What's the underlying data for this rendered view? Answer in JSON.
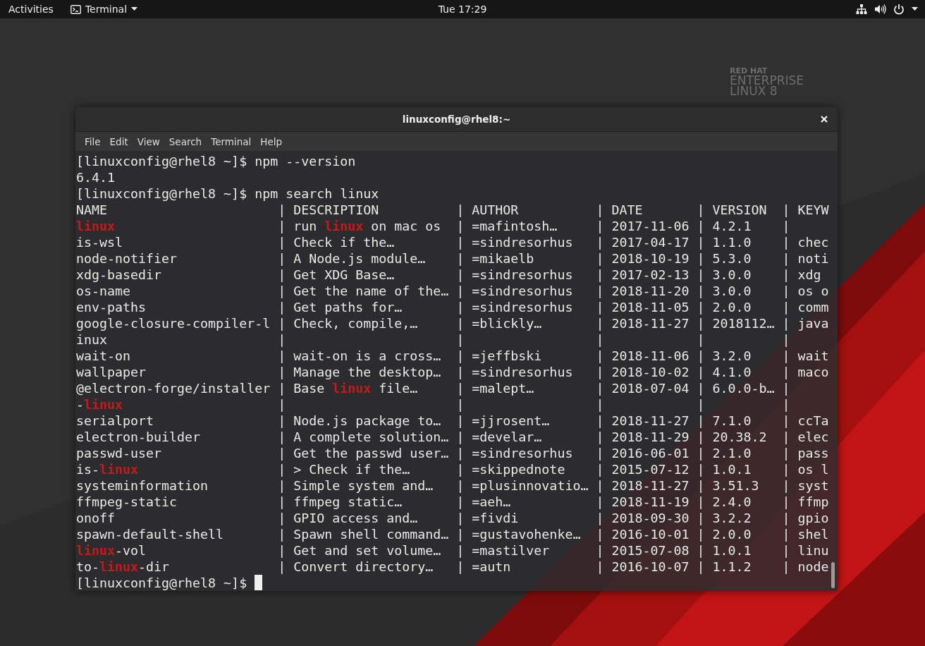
{
  "top_bar": {
    "activities": "Activities",
    "app_menu": "Terminal",
    "clock": "Tue 17:29"
  },
  "wallpaper": {
    "brand": [
      "RED HAT",
      "ENTERPRISE",
      "LINUX 8"
    ]
  },
  "window": {
    "title": "linuxconfig@rhel8:~",
    "menu": [
      "File",
      "Edit",
      "View",
      "Search",
      "Terminal",
      "Help"
    ],
    "lines": [
      {
        "cursor": false,
        "cells": [
          [
            {
              "text": "[linuxconfig@rhel8 ~]$ npm --version",
              "match": false
            }
          ]
        ]
      },
      {
        "cursor": false,
        "cells": [
          [
            {
              "text": "6.4.1",
              "match": false
            }
          ]
        ]
      },
      {
        "cursor": false,
        "cells": [
          [
            {
              "text": "[linuxconfig@rhel8 ~]$ npm search linux",
              "match": false
            }
          ]
        ]
      },
      {
        "cursor": false,
        "cells": [
          [
            {
              "text": "NAME",
              "match": false
            }
          ],
          [
            {
              "text": "| DESCRIPTION",
              "match": false
            }
          ],
          [
            {
              "text": "| AUTHOR",
              "match": false
            }
          ],
          [
            {
              "text": "| DATE",
              "match": false
            }
          ],
          [
            {
              "text": "| VERSION",
              "match": false
            }
          ],
          [
            {
              "text": "| KEYW",
              "match": false
            }
          ]
        ]
      },
      {
        "cursor": false,
        "cells": [
          [
            {
              "text": "linux",
              "match": true
            }
          ],
          [
            {
              "text": "| run ",
              "match": false
            },
            {
              "text": "linux",
              "match": true
            },
            {
              "text": " on mac os",
              "match": false
            }
          ],
          [
            {
              "text": "| =mafintosh…",
              "match": false
            }
          ],
          [
            {
              "text": "| 2017-11-06",
              "match": false
            }
          ],
          [
            {
              "text": "| 4.2.1",
              "match": false
            }
          ],
          [
            {
              "text": "|",
              "match": false
            }
          ]
        ]
      },
      {
        "cursor": false,
        "cells": [
          [
            {
              "text": "is-wsl",
              "match": false
            }
          ],
          [
            {
              "text": "| Check if the…",
              "match": false
            }
          ],
          [
            {
              "text": "| =sindresorhus",
              "match": false
            }
          ],
          [
            {
              "text": "| 2017-04-17",
              "match": false
            }
          ],
          [
            {
              "text": "| 1.1.0",
              "match": false
            }
          ],
          [
            {
              "text": "| chec",
              "match": false
            }
          ]
        ]
      },
      {
        "cursor": false,
        "cells": [
          [
            {
              "text": "node-notifier",
              "match": false
            }
          ],
          [
            {
              "text": "| A Node.js module…",
              "match": false
            }
          ],
          [
            {
              "text": "| =mikaelb",
              "match": false
            }
          ],
          [
            {
              "text": "| 2018-10-19",
              "match": false
            }
          ],
          [
            {
              "text": "| 5.3.0",
              "match": false
            }
          ],
          [
            {
              "text": "| noti",
              "match": false
            }
          ]
        ]
      },
      {
        "cursor": false,
        "cells": [
          [
            {
              "text": "xdg-basedir",
              "match": false
            }
          ],
          [
            {
              "text": "| Get XDG Base…",
              "match": false
            }
          ],
          [
            {
              "text": "| =sindresorhus",
              "match": false
            }
          ],
          [
            {
              "text": "| 2017-02-13",
              "match": false
            }
          ],
          [
            {
              "text": "| 3.0.0",
              "match": false
            }
          ],
          [
            {
              "text": "| xdg",
              "match": false
            }
          ]
        ]
      },
      {
        "cursor": false,
        "cells": [
          [
            {
              "text": "os-name",
              "match": false
            }
          ],
          [
            {
              "text": "| Get the name of the…",
              "match": false
            }
          ],
          [
            {
              "text": "| =sindresorhus",
              "match": false
            }
          ],
          [
            {
              "text": "| 2018-11-20",
              "match": false
            }
          ],
          [
            {
              "text": "| 3.0.0",
              "match": false
            }
          ],
          [
            {
              "text": "| os o",
              "match": false
            }
          ]
        ]
      },
      {
        "cursor": false,
        "cells": [
          [
            {
              "text": "env-paths",
              "match": false
            }
          ],
          [
            {
              "text": "| Get paths for…",
              "match": false
            }
          ],
          [
            {
              "text": "| =sindresorhus",
              "match": false
            }
          ],
          [
            {
              "text": "| 2018-11-05",
              "match": false
            }
          ],
          [
            {
              "text": "| 2.0.0",
              "match": false
            }
          ],
          [
            {
              "text": "| comm",
              "match": false
            }
          ]
        ]
      },
      {
        "cursor": false,
        "cells": [
          [
            {
              "text": "google-closure-compiler-l",
              "match": false
            }
          ],
          [
            {
              "text": "| Check, compile,…",
              "match": false
            }
          ],
          [
            {
              "text": "| =blickly…",
              "match": false
            }
          ],
          [
            {
              "text": "| 2018-11-27",
              "match": false
            }
          ],
          [
            {
              "text": "| 2018112…",
              "match": false
            }
          ],
          [
            {
              "text": "| java",
              "match": false
            }
          ]
        ]
      },
      {
        "cursor": false,
        "cells": [
          [
            {
              "text": "inux",
              "match": false
            }
          ],
          [
            {
              "text": "|",
              "match": false
            }
          ],
          [
            {
              "text": "|",
              "match": false
            }
          ],
          [
            {
              "text": "|",
              "match": false
            }
          ],
          [
            {
              "text": "|",
              "match": false
            }
          ],
          [
            {
              "text": "|",
              "match": false
            }
          ]
        ]
      },
      {
        "cursor": false,
        "cells": [
          [
            {
              "text": "wait-on",
              "match": false
            }
          ],
          [
            {
              "text": "| wait-on is a cross…",
              "match": false
            }
          ],
          [
            {
              "text": "| =jeffbski",
              "match": false
            }
          ],
          [
            {
              "text": "| 2018-11-06",
              "match": false
            }
          ],
          [
            {
              "text": "| 3.2.0",
              "match": false
            }
          ],
          [
            {
              "text": "| wait",
              "match": false
            }
          ]
        ]
      },
      {
        "cursor": false,
        "cells": [
          [
            {
              "text": "wallpaper",
              "match": false
            }
          ],
          [
            {
              "text": "| Manage the desktop…",
              "match": false
            }
          ],
          [
            {
              "text": "| =sindresorhus",
              "match": false
            }
          ],
          [
            {
              "text": "| 2018-10-02",
              "match": false
            }
          ],
          [
            {
              "text": "| 4.1.0",
              "match": false
            }
          ],
          [
            {
              "text": "| maco",
              "match": false
            }
          ]
        ]
      },
      {
        "cursor": false,
        "cells": [
          [
            {
              "text": "@electron-forge/installer",
              "match": false
            }
          ],
          [
            {
              "text": "| Base ",
              "match": false
            },
            {
              "text": "linux",
              "match": true
            },
            {
              "text": " file…",
              "match": false
            }
          ],
          [
            {
              "text": "| =malept…",
              "match": false
            }
          ],
          [
            {
              "text": "| 2018-07-04",
              "match": false
            }
          ],
          [
            {
              "text": "| 6.0.0-b…",
              "match": false
            }
          ],
          [
            {
              "text": "|",
              "match": false
            }
          ]
        ]
      },
      {
        "cursor": false,
        "cells": [
          [
            {
              "text": "-",
              "match": false
            },
            {
              "text": "linux",
              "match": true
            }
          ],
          [
            {
              "text": "|",
              "match": false
            }
          ],
          [
            {
              "text": "|",
              "match": false
            }
          ],
          [
            {
              "text": "|",
              "match": false
            }
          ],
          [
            {
              "text": "|",
              "match": false
            }
          ],
          [
            {
              "text": "|",
              "match": false
            }
          ]
        ]
      },
      {
        "cursor": false,
        "cells": [
          [
            {
              "text": "serialport",
              "match": false
            }
          ],
          [
            {
              "text": "| Node.js package to…",
              "match": false
            }
          ],
          [
            {
              "text": "| =jjrosent…",
              "match": false
            }
          ],
          [
            {
              "text": "| 2018-11-27",
              "match": false
            }
          ],
          [
            {
              "text": "| 7.1.0",
              "match": false
            }
          ],
          [
            {
              "text": "| ccTa",
              "match": false
            }
          ]
        ]
      },
      {
        "cursor": false,
        "cells": [
          [
            {
              "text": "electron-builder",
              "match": false
            }
          ],
          [
            {
              "text": "| A complete solution…",
              "match": false
            }
          ],
          [
            {
              "text": "| =develar…",
              "match": false
            }
          ],
          [
            {
              "text": "| 2018-11-29",
              "match": false
            }
          ],
          [
            {
              "text": "| 20.38.2",
              "match": false
            }
          ],
          [
            {
              "text": "| elec",
              "match": false
            }
          ]
        ]
      },
      {
        "cursor": false,
        "cells": [
          [
            {
              "text": "passwd-user",
              "match": false
            }
          ],
          [
            {
              "text": "| Get the passwd user…",
              "match": false
            }
          ],
          [
            {
              "text": "| =sindresorhus",
              "match": false
            }
          ],
          [
            {
              "text": "| 2016-06-01",
              "match": false
            }
          ],
          [
            {
              "text": "| 2.1.0",
              "match": false
            }
          ],
          [
            {
              "text": "| pass",
              "match": false
            }
          ]
        ]
      },
      {
        "cursor": false,
        "cells": [
          [
            {
              "text": "is-",
              "match": false
            },
            {
              "text": "linux",
              "match": true
            }
          ],
          [
            {
              "text": "| > Check if the…",
              "match": false
            }
          ],
          [
            {
              "text": "| =skippednote",
              "match": false
            }
          ],
          [
            {
              "text": "| 2015-07-12",
              "match": false
            }
          ],
          [
            {
              "text": "| 1.0.1",
              "match": false
            }
          ],
          [
            {
              "text": "| os l",
              "match": false
            }
          ]
        ]
      },
      {
        "cursor": false,
        "cells": [
          [
            {
              "text": "systeminformation",
              "match": false
            }
          ],
          [
            {
              "text": "| Simple system and…",
              "match": false
            }
          ],
          [
            {
              "text": "| =plusinnovatio…",
              "match": false
            }
          ],
          [
            {
              "text": "| 2018-11-27",
              "match": false
            }
          ],
          [
            {
              "text": "| 3.51.3",
              "match": false
            }
          ],
          [
            {
              "text": "| syst",
              "match": false
            }
          ]
        ]
      },
      {
        "cursor": false,
        "cells": [
          [
            {
              "text": "ffmpeg-static",
              "match": false
            }
          ],
          [
            {
              "text": "| ffmpeg static…",
              "match": false
            }
          ],
          [
            {
              "text": "| =aeh…",
              "match": false
            }
          ],
          [
            {
              "text": "| 2018-11-19",
              "match": false
            }
          ],
          [
            {
              "text": "| 2.4.0",
              "match": false
            }
          ],
          [
            {
              "text": "| ffmp",
              "match": false
            }
          ]
        ]
      },
      {
        "cursor": false,
        "cells": [
          [
            {
              "text": "onoff",
              "match": false
            }
          ],
          [
            {
              "text": "| GPIO access and…",
              "match": false
            }
          ],
          [
            {
              "text": "| =fivdi",
              "match": false
            }
          ],
          [
            {
              "text": "| 2018-09-30",
              "match": false
            }
          ],
          [
            {
              "text": "| 3.2.2",
              "match": false
            }
          ],
          [
            {
              "text": "| gpio",
              "match": false
            }
          ]
        ]
      },
      {
        "cursor": false,
        "cells": [
          [
            {
              "text": "spawn-default-shell",
              "match": false
            }
          ],
          [
            {
              "text": "| Spawn shell command…",
              "match": false
            }
          ],
          [
            {
              "text": "| =gustavohenke…",
              "match": false
            }
          ],
          [
            {
              "text": "| 2016-10-01",
              "match": false
            }
          ],
          [
            {
              "text": "| 2.0.0",
              "match": false
            }
          ],
          [
            {
              "text": "| shel",
              "match": false
            }
          ]
        ]
      },
      {
        "cursor": false,
        "cells": [
          [
            {
              "text": "linux",
              "match": true
            },
            {
              "text": "-vol",
              "match": false
            }
          ],
          [
            {
              "text": "| Get and set volume…",
              "match": false
            }
          ],
          [
            {
              "text": "| =mastilver",
              "match": false
            }
          ],
          [
            {
              "text": "| 2015-07-08",
              "match": false
            }
          ],
          [
            {
              "text": "| 1.0.1",
              "match": false
            }
          ],
          [
            {
              "text": "| linu",
              "match": false
            }
          ]
        ]
      },
      {
        "cursor": false,
        "cells": [
          [
            {
              "text": "to-",
              "match": false
            },
            {
              "text": "linux",
              "match": true
            },
            {
              "text": "-dir",
              "match": false
            }
          ],
          [
            {
              "text": "| Convert directory…",
              "match": false
            }
          ],
          [
            {
              "text": "| =autn",
              "match": false
            }
          ],
          [
            {
              "text": "| 2016-10-07",
              "match": false
            }
          ],
          [
            {
              "text": "| 1.1.2",
              "match": false
            }
          ],
          [
            {
              "text": "| node",
              "match": false
            }
          ]
        ]
      },
      {
        "cursor": true,
        "cells": [
          [
            {
              "text": "[linuxconfig@rhel8 ~]$ ",
              "match": false
            }
          ]
        ]
      }
    ]
  }
}
